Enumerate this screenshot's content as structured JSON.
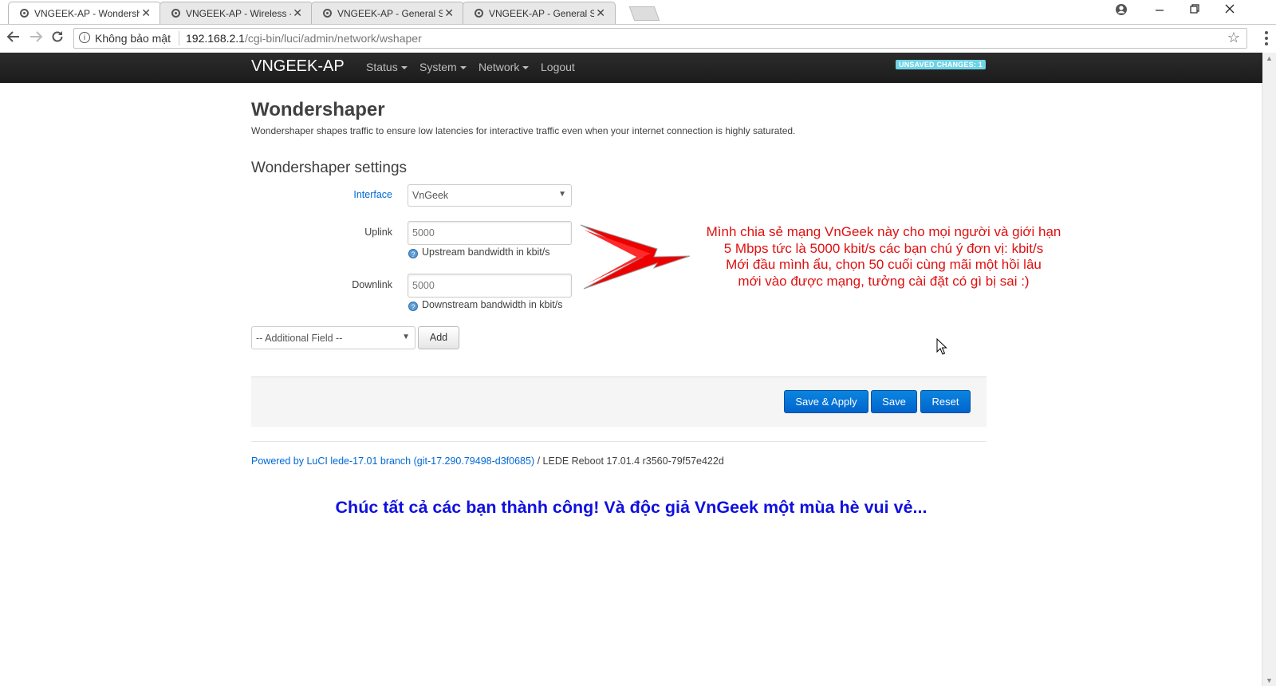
{
  "browser": {
    "tabs": [
      {
        "title": "VNGEEK-AP - Wondershaper",
        "active": true
      },
      {
        "title": "VNGEEK-AP - Wireless - LuCI",
        "active": false
      },
      {
        "title": "VNGEEK-AP - General Settings",
        "active": false
      },
      {
        "title": "VNGEEK-AP - General Settings",
        "active": false
      }
    ],
    "security_label": "Không bảo mật",
    "url_host": "192.168.2.1",
    "url_path": "/cgi-bin/luci/admin/network/wshaper"
  },
  "header": {
    "brand": "VNGEEK-AP",
    "menu": [
      "Status",
      "System",
      "Network",
      "Logout"
    ],
    "unsaved": "UNSAVED CHANGES: 1"
  },
  "page": {
    "title": "Wondershaper",
    "description": "Wondershaper shapes traffic to ensure low latencies for interactive traffic even when your internet connection is highly saturated.",
    "section_title": "Wondershaper settings",
    "interface_label": "Interface",
    "interface_value": "VnGeek",
    "uplink_label": "Uplink",
    "uplink_value": "5000",
    "uplink_hint": "Upstream bandwidth in kbit/s",
    "downlink_label": "Downlink",
    "downlink_value": "5000",
    "downlink_hint": "Downstream bandwidth in kbit/s",
    "additional_field": "-- Additional Field --",
    "add_button": "Add"
  },
  "actions": {
    "save_apply": "Save & Apply",
    "save": "Save",
    "reset": "Reset"
  },
  "footer": {
    "powered": "Powered by LuCI lede-17.01 branch (git-17.290.79498-d3f0685)",
    "version": " / LEDE Reboot 17.01.4 r3560-79f57e422d"
  },
  "annotation": {
    "lines": [
      "Mình chia sẻ mạng VnGeek này cho mọi người và giới hạn",
      "5 Mbps tức là 5000 kbit/s các bạn chú ý đơn vị: kbit/s",
      "Mới đầu mình ẩu, chọn 50 cuối cùng mãi một hồi lâu",
      "mới vào được mạng, tưởng cài đặt có gì bị sai :)"
    ],
    "closing": "Chúc tất cả các bạn thành công! Và độc giả VnGeek một mùa hè vui vẻ..."
  },
  "colors": {
    "annotation_red": "#e01010",
    "closing_blue": "#1010e0",
    "primary_button": "#0069d6",
    "navbar": "#222222",
    "unsaved_badge": "#6ed3e6"
  }
}
